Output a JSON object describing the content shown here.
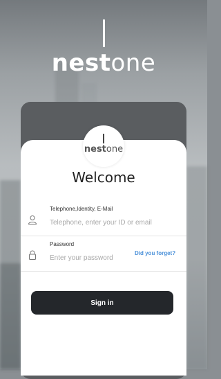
{
  "header": {
    "logo_part1": "nest",
    "logo_part2": "one"
  },
  "card": {
    "logo_part1": "nest",
    "logo_part2": "one",
    "title": "Welcome"
  },
  "form": {
    "identity": {
      "label": "Telephone,Identity, E-Mail",
      "placeholder": "Telephone, enter your ID or email",
      "value": "",
      "icon": "user-icon"
    },
    "password": {
      "label": "Password",
      "placeholder": "Enter your password",
      "value": "",
      "icon": "lock-icon"
    },
    "forgot_label": "Did you forget?",
    "submit_label": "Sign in"
  },
  "colors": {
    "accent": "#4a90d9",
    "button_bg": "#24272b",
    "card_bg": "#ffffff"
  }
}
